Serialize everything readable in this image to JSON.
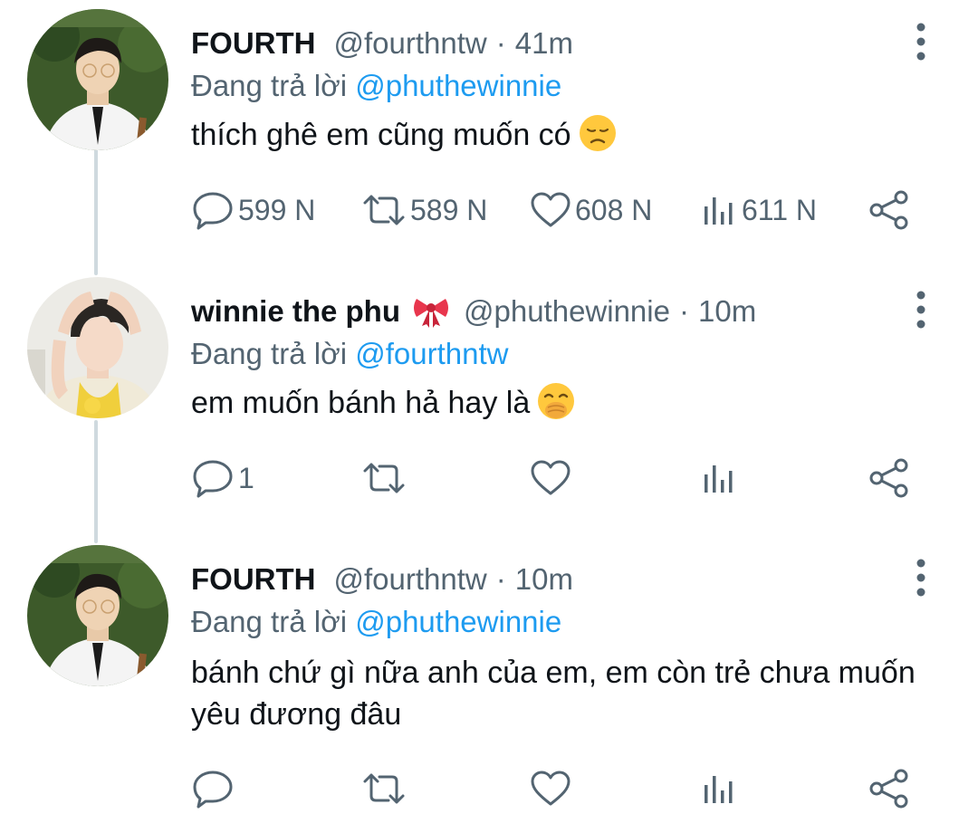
{
  "tweets": [
    {
      "name": "FOURTH",
      "handle": "@fourthntw",
      "time": "41m",
      "reply_prefix": "Đang trả lời",
      "reply_to": "@phuthewinnie",
      "text": "thích ghê em cũng muốn có",
      "text_emoji": "disappointed-face",
      "reply_count": "599 N",
      "retweet_count": "589 N",
      "like_count": "608 N",
      "view_count": "611 N"
    },
    {
      "name": "winnie the phu",
      "name_emoji": "ribbon",
      "handle": "@phuthewinnie",
      "time": "10m",
      "reply_prefix": "Đang trả lời",
      "reply_to": "@fourthntw",
      "text": "em muốn bánh hả hay là",
      "text_emoji": "face-with-hand-over-mouth",
      "reply_count": "1",
      "retweet_count": "",
      "like_count": "",
      "view_count": ""
    },
    {
      "name": "FOURTH",
      "handle": "@fourthntw",
      "time": "10m",
      "reply_prefix": "Đang trả lời",
      "reply_to": "@phuthewinnie",
      "text": "bánh chứ gì nữa anh của em, em còn trẻ chưa muốn yêu đương đâu",
      "reply_count": "",
      "retweet_count": "",
      "like_count": "",
      "view_count": ""
    }
  ],
  "colors": {
    "secondary_text": "#536471",
    "mention": "#1d9bf0",
    "thread_line": "#cfd9de"
  }
}
